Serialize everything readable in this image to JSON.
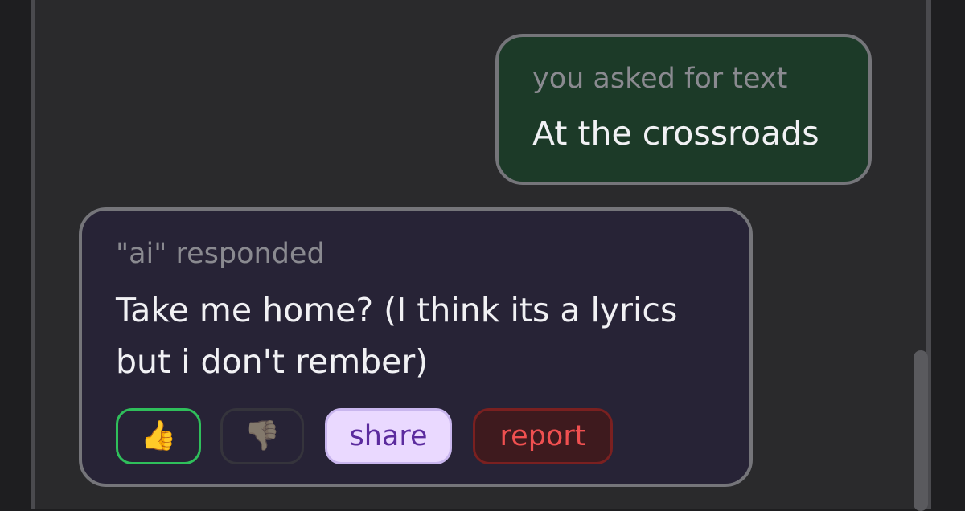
{
  "user_message": {
    "meta": "you asked for text",
    "text": "At the crossroads"
  },
  "ai_message": {
    "meta": "\"ai\" responded",
    "line1": "Take me home? (I think its a lyrics",
    "line2": "but i don't rember)"
  },
  "actions": {
    "thumbs_up": "👍",
    "thumbs_down": "👎",
    "share_label": "share",
    "report_label": "report"
  },
  "colors": {
    "user_bubble": "#1c3a28",
    "ai_bubble": "#272336",
    "thumbs_up_border": "#2fbf5b",
    "share_bg": "#ead9ff",
    "share_text": "#5b2b9e",
    "report_text": "#f05050"
  },
  "icons": {
    "thumbs_up": "thumbs-up-icon",
    "thumbs_down": "thumbs-down-icon"
  }
}
